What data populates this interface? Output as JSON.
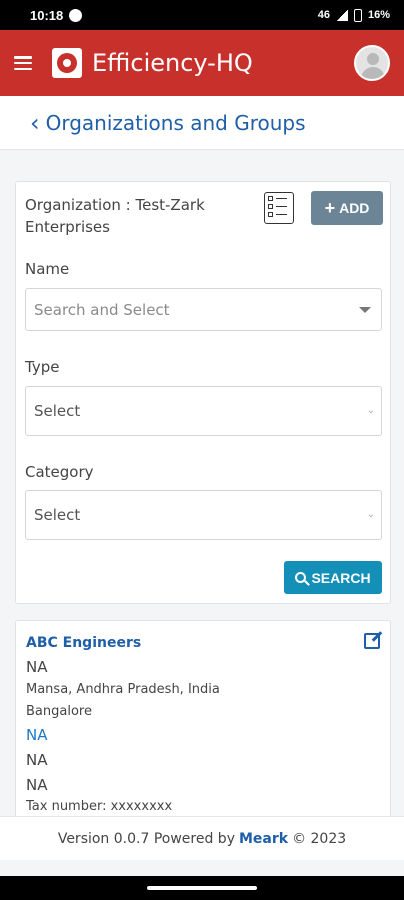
{
  "status_bar": {
    "time": "10:18",
    "network": "46",
    "battery": "16%"
  },
  "app_bar": {
    "title": "Efficiency-HQ"
  },
  "page_header": {
    "title": "Organizations and Groups"
  },
  "filter": {
    "organization_label": "Organization : Test-Zark Enterprises",
    "add_label": "ADD",
    "name_label": "Name",
    "name_placeholder": "Search and Select",
    "type_label": "Type",
    "type_value": "Select",
    "category_label": "Category",
    "category_value": "Select",
    "search_label": "SEARCH"
  },
  "result": {
    "name": "ABC Engineers",
    "line1": "NA",
    "address": "Mansa, Andhra Pradesh, India",
    "city": "Bangalore",
    "link": "NA",
    "line2": "NA",
    "line3": "NA",
    "tax": "Tax number: xxxxxxxx"
  },
  "footer": {
    "prefix": "Version 0.0.7 Powered by",
    "brand": "Meark",
    "suffix": "© 2023"
  },
  "colors": {
    "primary": "#c8302c",
    "accent": "#1f5fa8",
    "search": "#138fb8"
  }
}
